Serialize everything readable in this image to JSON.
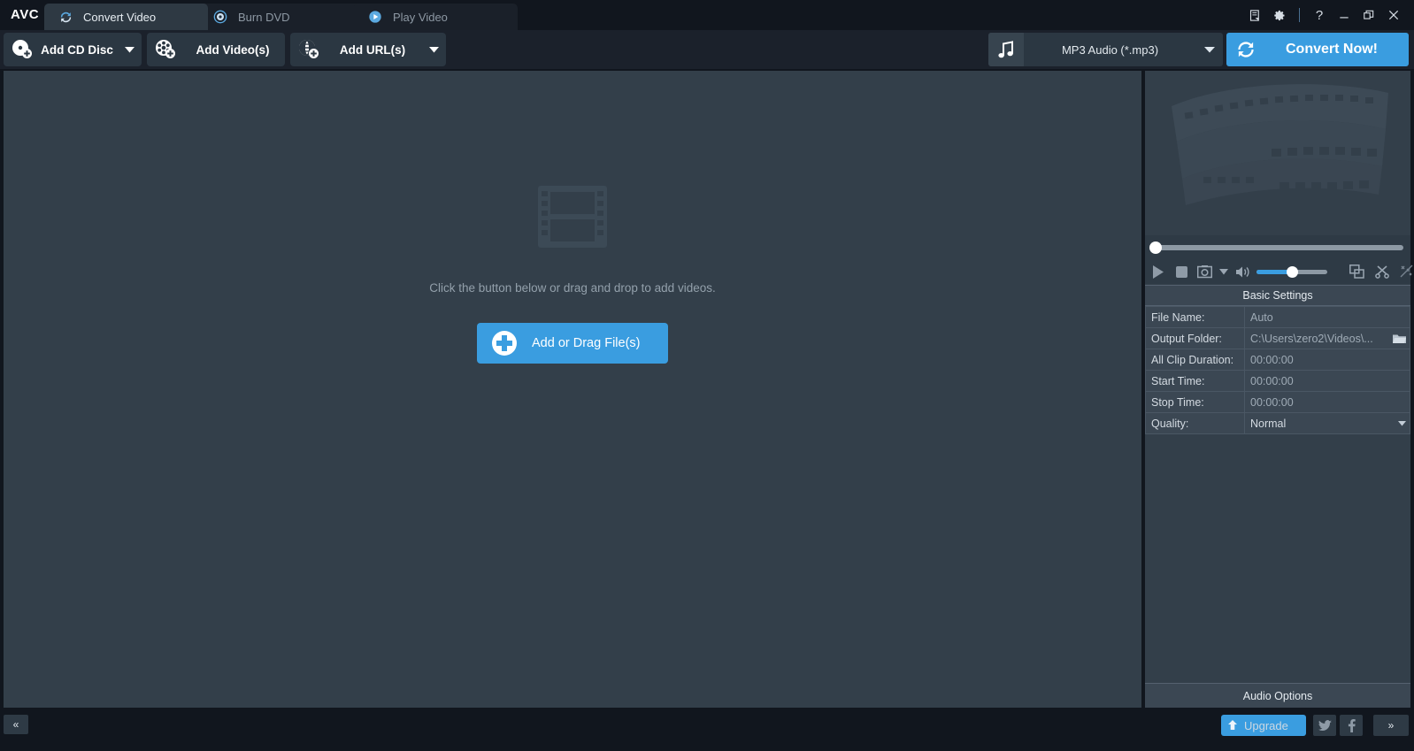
{
  "app": {
    "logo": "AVC",
    "accent_color": "#3a9de0",
    "panel_color": "#333f4a",
    "chrome_color": "#11161e"
  },
  "titlebar": {
    "tabs": [
      {
        "label": "Convert Video",
        "icon": "convert-arrows-icon",
        "active": true
      },
      {
        "label": "Burn DVD",
        "icon": "disc-icon",
        "active": false
      },
      {
        "label": "Play Video",
        "icon": "play-circle-icon",
        "active": false
      }
    ],
    "window_controls": [
      {
        "name": "log-icon",
        "glyph": "log"
      },
      {
        "name": "settings-gear-icon",
        "glyph": "gear"
      },
      {
        "name": "help-icon",
        "glyph": "?"
      },
      {
        "name": "minimize-icon",
        "glyph": "minimize"
      },
      {
        "name": "restore-icon",
        "glyph": "restore"
      },
      {
        "name": "close-icon",
        "glyph": "close"
      }
    ]
  },
  "toolbar": {
    "add_cd_disc": {
      "label": "Add CD Disc",
      "icon": "cd-add-icon",
      "has_caret": true
    },
    "add_videos": {
      "label": "Add Video(s)",
      "icon": "film-reel-add-icon",
      "has_caret": false
    },
    "add_urls": {
      "label": "Add URL(s)",
      "icon": "globe-add-icon",
      "has_caret": true
    },
    "format_selector": {
      "value": "MP3 Audio (*.mp3)",
      "icon": "music-note-icon"
    },
    "convert_button": {
      "label": "Convert Now!",
      "icon": "convert-arrows-icon"
    }
  },
  "main": {
    "empty_state": {
      "icon": "film-strip-icon",
      "hint": "Click the button below or drag and drop to add videos.",
      "button_label": "Add or Drag File(s)",
      "button_icon": "plus-circle-icon"
    }
  },
  "right_panel": {
    "preview": {
      "icon": "film-strip-watermark"
    },
    "seek": {
      "position_percent": 0
    },
    "player_controls": [
      {
        "name": "play-button",
        "icon": "play-icon"
      },
      {
        "name": "stop-button",
        "icon": "stop-icon"
      },
      {
        "name": "snapshot-button",
        "icon": "camera-icon"
      },
      {
        "name": "snapshot-menu",
        "icon": "chevron-down-icon"
      },
      {
        "name": "volume-button",
        "icon": "speaker-icon"
      },
      {
        "name": "volume-slider",
        "icon": "slider-icon"
      },
      {
        "name": "crop-button",
        "icon": "crop-icon"
      },
      {
        "name": "trim-button",
        "icon": "scissors-icon"
      },
      {
        "name": "effects-button",
        "icon": "sparkle-icon"
      }
    ],
    "volume_percent": 45,
    "basic_settings": {
      "title": "Basic Settings",
      "rows": [
        {
          "key": "File Name:",
          "value": "Auto",
          "icon": null
        },
        {
          "key": "Output Folder:",
          "value": "C:\\Users\\zero2\\Videos\\...",
          "icon": "folder-browse-icon"
        },
        {
          "key": "All Clip Duration:",
          "value": "00:00:00",
          "icon": null
        },
        {
          "key": "Start Time:",
          "value": "00:00:00",
          "icon": null
        },
        {
          "key": "Stop Time:",
          "value": "00:00:00",
          "icon": null
        },
        {
          "key": "Quality:",
          "value": "Normal",
          "icon": "chevron-down-icon"
        }
      ]
    },
    "audio_options": {
      "label": "Audio Options"
    }
  },
  "statusbar": {
    "collapse_label": "«",
    "expand_label": "»",
    "upgrade": {
      "label": "Upgrade",
      "icon": "up-arrow-icon"
    },
    "social": [
      {
        "name": "twitter-icon",
        "label": "twitter"
      },
      {
        "name": "facebook-icon",
        "label": "f"
      }
    ]
  }
}
